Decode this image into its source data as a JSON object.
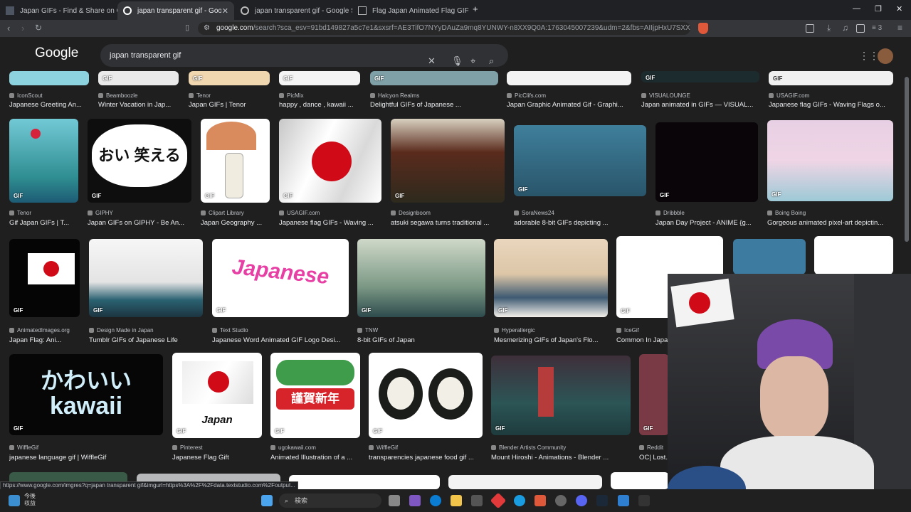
{
  "tabs": [
    {
      "label": "Japan GIFs - Find & Share on GIPHY"
    },
    {
      "label": "japan transparent gif - Google Se"
    },
    {
      "label": "japan transparent gif - Google Searc"
    },
    {
      "label": "Flag Japan Animated Flag GIF"
    }
  ],
  "address": {
    "host": "google.com",
    "path": "/search?sca_esv=91bd149827a5c7e1&sxsrf=AE3TifO7NYyDAuZa9mq8YUNWY-n8XX9Q0A:1763045007239&udm=2&fbs=AIIjpHxU7SXXniUZfeShr2..."
  },
  "extension_badge": "3",
  "logo": "Google",
  "search": {
    "query": "japan transparent gif"
  },
  "gif_label": "GIF",
  "row0": [
    {
      "source": "IconScout",
      "title": "Japanese Greeting An..."
    },
    {
      "source": "Beamboozle",
      "title": "Winter Vacation in Jap..."
    },
    {
      "source": "Tenor",
      "title": "Japan GIFs | Tenor"
    },
    {
      "source": "PicMix",
      "title": "happy , dance , kawaii ..."
    },
    {
      "source": "Halcyon Realms",
      "title": "Delightful GIFs of Japanese ..."
    },
    {
      "source": "PicClifs.com",
      "title": "Japan Graphic Animated Gif - Graphi..."
    },
    {
      "source": "VISUALOUNGE",
      "title": "Japan animated in GIFs — VISUAL..."
    },
    {
      "source": "USAGIF.com",
      "title": "Japanese flag GIFs - Waving Flags o..."
    }
  ],
  "row1": [
    {
      "source": "Tenor",
      "title": "Gif Japan GIFs | T..."
    },
    {
      "source": "GIPHY",
      "title": "Japan GIFs on GIPHY - Be An..."
    },
    {
      "source": "Clipart Library",
      "title": "Japan Geography ..."
    },
    {
      "source": "USAGIF.com",
      "title": "Japanese flag GIFs - Waving ..."
    },
    {
      "source": "Designboom",
      "title": "atsuki segawa turns traditional ..."
    },
    {
      "source": "SoraNews24",
      "title": "adorable 8-bit GIFs depicting ..."
    },
    {
      "source": "Dribbble",
      "title": "Japan Day Project - ANIME {g..."
    },
    {
      "source": "Boing Boing",
      "title": "Gorgeous animated pixel-art depictin..."
    }
  ],
  "row2": [
    {
      "source": "AnimatedImages.org",
      "title": "Japan Flag: Ani..."
    },
    {
      "source": "Design Made in Japan",
      "title": "Tumblr GIFs of Japanese Life"
    },
    {
      "source": "Text Studio",
      "title": "Japanese Word Animated GIF Logo Desi..."
    },
    {
      "source": "TNW",
      "title": "8-bit GIFs of Japan"
    },
    {
      "source": "Hyperallergic",
      "title": "Mesmerizing GIFs of Japan's Flo..."
    },
    {
      "source": "IceGif",
      "title": "Common In Japa..."
    }
  ],
  "row3": [
    {
      "source": "WiffleGif",
      "title": "japanese language gif | WiffleGif"
    },
    {
      "source": "Pinterest",
      "title": "Japanese Flag Gift"
    },
    {
      "source": "ugokawaii.com",
      "title": "Animated Illustration of a ..."
    },
    {
      "source": "WiffleGif",
      "title": "transparencies japanese food gif ..."
    },
    {
      "source": "Blender Artists Community",
      "title": "Mount Hiroshi - Animations - Blender ..."
    },
    {
      "source": "Reddit",
      "title": "OC| Lost..."
    }
  ],
  "image_text": {
    "oi": "おい 笑える",
    "japanese": "Japanese",
    "kawaii_jp": "かわいい",
    "kawaii": "kawaii",
    "japan": "Japan",
    "newyear": "謹賀新年"
  },
  "status_url": "https://www.google.com/imgres?q=japan transparent gif&imgurl=https%3A%2F%2Fdata.textstudio.com%2Foutput...",
  "taskbar": {
    "weather_line1": "今後",
    "weather_line2": "収益",
    "search": "検索"
  }
}
